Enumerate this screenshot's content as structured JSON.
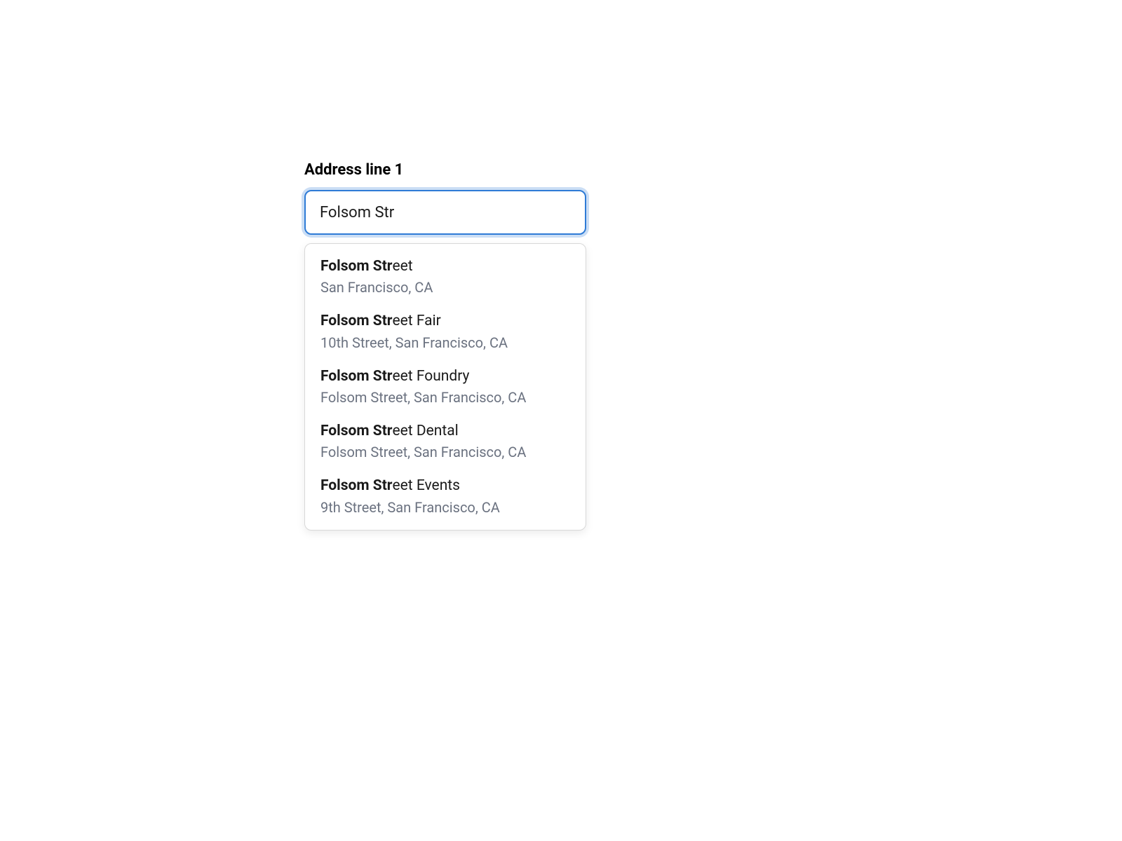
{
  "field": {
    "label": "Address line 1",
    "value": "Folsom Str"
  },
  "query_match": "Folsom Str",
  "suggestions": [
    {
      "title_match": "Folsom Str",
      "title_rest": "eet",
      "subtitle": "San Francisco, CA"
    },
    {
      "title_match": "Folsom Str",
      "title_rest": "eet Fair",
      "subtitle": "10th Street, San Francisco, CA"
    },
    {
      "title_match": "Folsom Str",
      "title_rest": "eet Foundry",
      "subtitle": "Folsom Street, San Francisco, CA"
    },
    {
      "title_match": "Folsom Str",
      "title_rest": "eet Dental",
      "subtitle": "Folsom Street, San Francisco, CA"
    },
    {
      "title_match": "Folsom Str",
      "title_rest": "eet Events",
      "subtitle": "9th Street, San Francisco, CA"
    }
  ]
}
